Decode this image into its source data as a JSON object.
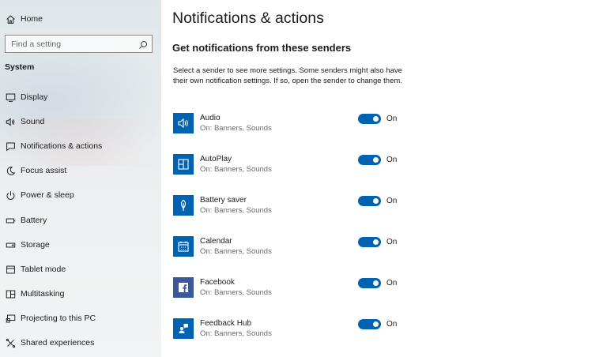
{
  "sidebar": {
    "home": {
      "label": "Home",
      "icon": "home-icon"
    },
    "search": {
      "placeholder": "Find a setting",
      "icon": "search-icon"
    },
    "section": "System",
    "items": [
      {
        "label": "Display",
        "icon": "display-icon"
      },
      {
        "label": "Sound",
        "icon": "sound-icon"
      },
      {
        "label": "Notifications & actions",
        "icon": "notifications-icon"
      },
      {
        "label": "Focus assist",
        "icon": "focus-assist-icon"
      },
      {
        "label": "Power & sleep",
        "icon": "power-icon"
      },
      {
        "label": "Battery",
        "icon": "battery-icon"
      },
      {
        "label": "Storage",
        "icon": "storage-icon"
      },
      {
        "label": "Tablet mode",
        "icon": "tablet-mode-icon"
      },
      {
        "label": "Multitasking",
        "icon": "multitasking-icon"
      },
      {
        "label": "Projecting to this PC",
        "icon": "projecting-icon"
      },
      {
        "label": "Shared experiences",
        "icon": "shared-experiences-icon"
      }
    ]
  },
  "main": {
    "title": "Notifications & actions",
    "subtitle": "Get notifications from these senders",
    "description": "Select a sender to see more settings. Some senders might also have their own notification settings. If so, open the sender to change them.",
    "accent_color": "#0063b1",
    "senders": [
      {
        "name": "Audio",
        "detail": "On: Banners, Sounds",
        "toggle": "On",
        "icon": "audio-app-icon"
      },
      {
        "name": "AutoPlay",
        "detail": "On: Banners, Sounds",
        "toggle": "On",
        "icon": "autoplay-app-icon"
      },
      {
        "name": "Battery saver",
        "detail": "On: Banners, Sounds",
        "toggle": "On",
        "icon": "battery-saver-app-icon"
      },
      {
        "name": "Calendar",
        "detail": "On: Banners, Sounds",
        "toggle": "On",
        "icon": "calendar-app-icon"
      },
      {
        "name": "Facebook",
        "detail": "On: Banners, Sounds",
        "toggle": "On",
        "icon": "facebook-app-icon"
      },
      {
        "name": "Feedback Hub",
        "detail": "On: Banners, Sounds",
        "toggle": "On",
        "icon": "feedback-hub-app-icon"
      }
    ]
  }
}
